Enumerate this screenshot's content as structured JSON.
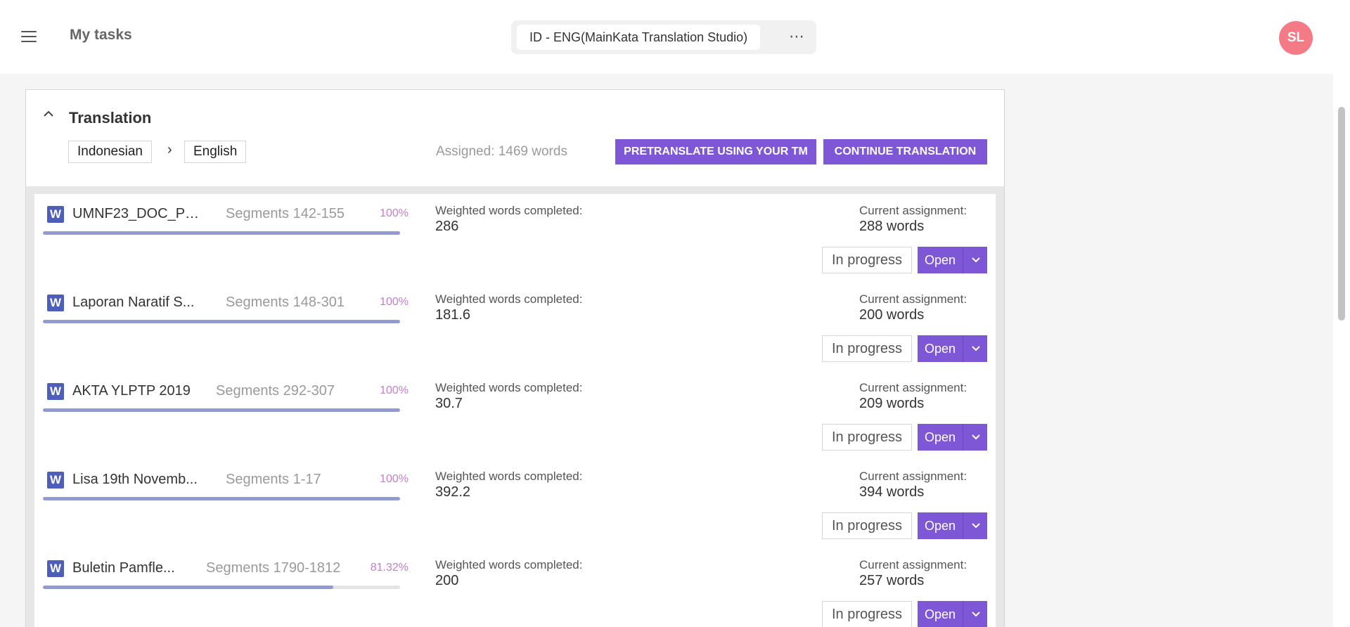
{
  "header": {
    "title": "My tasks",
    "project": "ID - ENG(MainKata Translation Studio)",
    "more_label": "⋯",
    "avatar_initials": "SL"
  },
  "card": {
    "title": "Translation",
    "source_lang": "Indonesian",
    "arrow": "›",
    "target_lang": "English",
    "assigned": "Assigned: 1469 words",
    "btn_pretranslate": "PRETRANSLATE USING YOUR TM",
    "btn_continue": "CONTINUE TRANSLATION"
  },
  "tasks": [
    {
      "icon": "W",
      "name": "UMNF23_DOC_PO...",
      "segments": "Segments 142-155",
      "percent": "100%",
      "progress": 1.0,
      "wwc_label": "Weighted words completed:",
      "wwc": "286",
      "ca_label": "Current assignment:",
      "ca": "288 words",
      "status": "In progress",
      "open": "Open"
    },
    {
      "icon": "W",
      "name": "Laporan Naratif S...",
      "segments": "Segments 148-301",
      "percent": "100%",
      "progress": 1.0,
      "wwc_label": "Weighted words completed:",
      "wwc": "181.6",
      "ca_label": "Current assignment:",
      "ca": "200 words",
      "status": "In progress",
      "open": "Open"
    },
    {
      "icon": "W",
      "name": "AKTA YLPTP 2019",
      "segments": "Segments 292-307",
      "percent": "100%",
      "progress": 1.0,
      "wwc_label": "Weighted words completed:",
      "wwc": "30.7",
      "ca_label": "Current assignment:",
      "ca": "209 words",
      "status": "In progress",
      "open": "Open"
    },
    {
      "icon": "W",
      "name": "Lisa 19th Novemb...",
      "segments": "Segments 1-17",
      "percent": "100%",
      "progress": 1.0,
      "wwc_label": "Weighted words completed:",
      "wwc": "392.2",
      "ca_label": "Current assignment:",
      "ca": "394 words",
      "status": "In progress",
      "open": "Open"
    },
    {
      "icon": "W",
      "name": "Buletin Pamfle...",
      "segments": "Segments 1790-1812",
      "percent": "81.32%",
      "progress": 0.8132,
      "wwc_label": "Weighted words completed:",
      "wwc": "200",
      "ca_label": "Current assignment:",
      "ca": "257 words",
      "status": "In progress",
      "open": "Open"
    }
  ],
  "icons": {
    "menu": "menu-icon",
    "collapse": "chevron-up-icon",
    "more": "more-horizontal-icon",
    "word_file": "word-file-icon",
    "dropdown": "chevron-down-icon"
  },
  "colors": {
    "accent": "#7e57d6",
    "progress": "#8f9ad6",
    "percent": "#c77bd1",
    "avatar": "#f47a86",
    "word_icon": "#4d5fb8"
  }
}
